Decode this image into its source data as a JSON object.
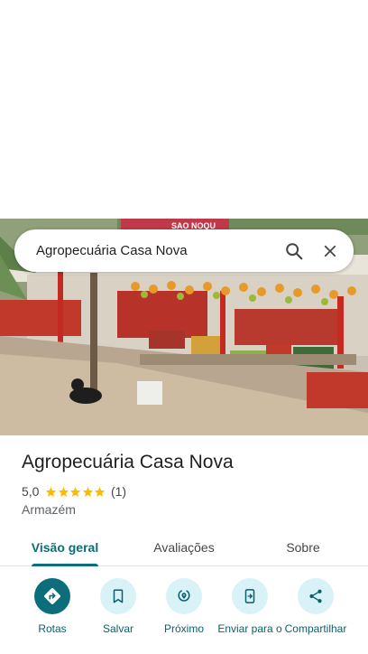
{
  "search": {
    "query": "Agropecuária Casa Nova"
  },
  "photo": {
    "sign_text": "SAO NOQU"
  },
  "place": {
    "name": "Agropecuária Casa Nova",
    "rating": "5,0",
    "stars": 5,
    "review_count": "(1)",
    "category": "Armazém"
  },
  "tabs": [
    {
      "label": "Visão geral",
      "active": true
    },
    {
      "label": "Avaliações",
      "active": false
    },
    {
      "label": "Sobre",
      "active": false
    }
  ],
  "actions": [
    {
      "label": "Rotas",
      "icon": "directions-icon"
    },
    {
      "label": "Salvar",
      "icon": "bookmark-icon"
    },
    {
      "label": "Próximo",
      "icon": "nearby-icon"
    },
    {
      "label": "Enviar para o",
      "icon": "send-to-phone-icon"
    },
    {
      "label": "Compartilhar",
      "icon": "share-icon"
    }
  ],
  "colors": {
    "accent": "#0b6e7a",
    "action_bg": "#d8f2f8",
    "star": "#fbbc04"
  }
}
